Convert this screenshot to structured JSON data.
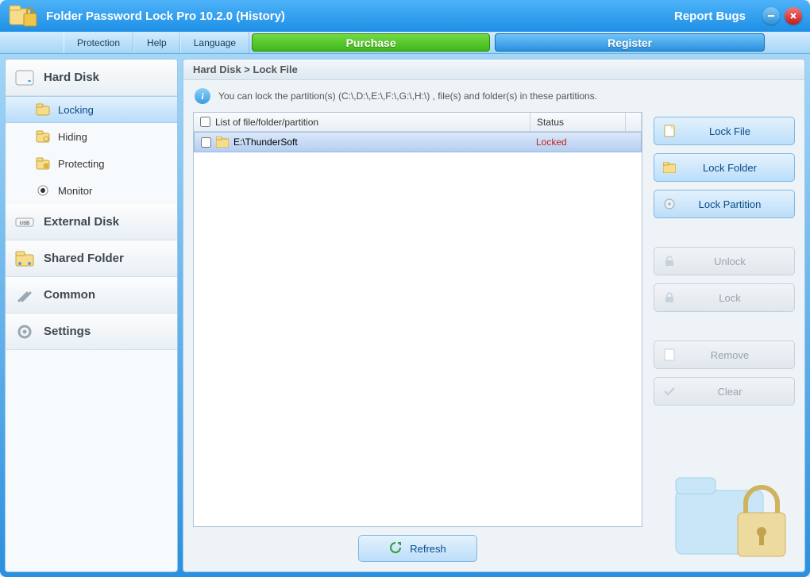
{
  "title": "Folder Password Lock Pro 10.2.0 (History)",
  "header": {
    "report_bugs": "Report Bugs"
  },
  "menu": {
    "protection": "Protection",
    "help": "Help",
    "language": "Language",
    "purchase": "Purchase",
    "register": "Register"
  },
  "sidebar": {
    "hard_disk": "Hard Disk",
    "hard_disk_items": {
      "locking": "Locking",
      "hiding": "Hiding",
      "protecting": "Protecting",
      "monitor": "Monitor"
    },
    "external_disk": "External Disk",
    "shared_folder": "Shared Folder",
    "common": "Common",
    "settings": "Settings"
  },
  "main": {
    "breadcrumb": "Hard Disk > Lock File",
    "info": "You can lock the partition(s) (C:\\,D:\\,E:\\,F:\\,G:\\,H:\\) , file(s) and folder(s) in these partitions.",
    "columns": {
      "name": "List of file/folder/partition",
      "status": "Status"
    },
    "rows": [
      {
        "path": "E:\\ThunderSoft",
        "status": "Locked"
      }
    ],
    "refresh": "Refresh"
  },
  "actions": {
    "lock_file": "Lock File",
    "lock_folder": "Lock Folder",
    "lock_partition": "Lock Partition",
    "unlock": "Unlock",
    "lock": "Lock",
    "remove": "Remove",
    "clear": "Clear"
  }
}
